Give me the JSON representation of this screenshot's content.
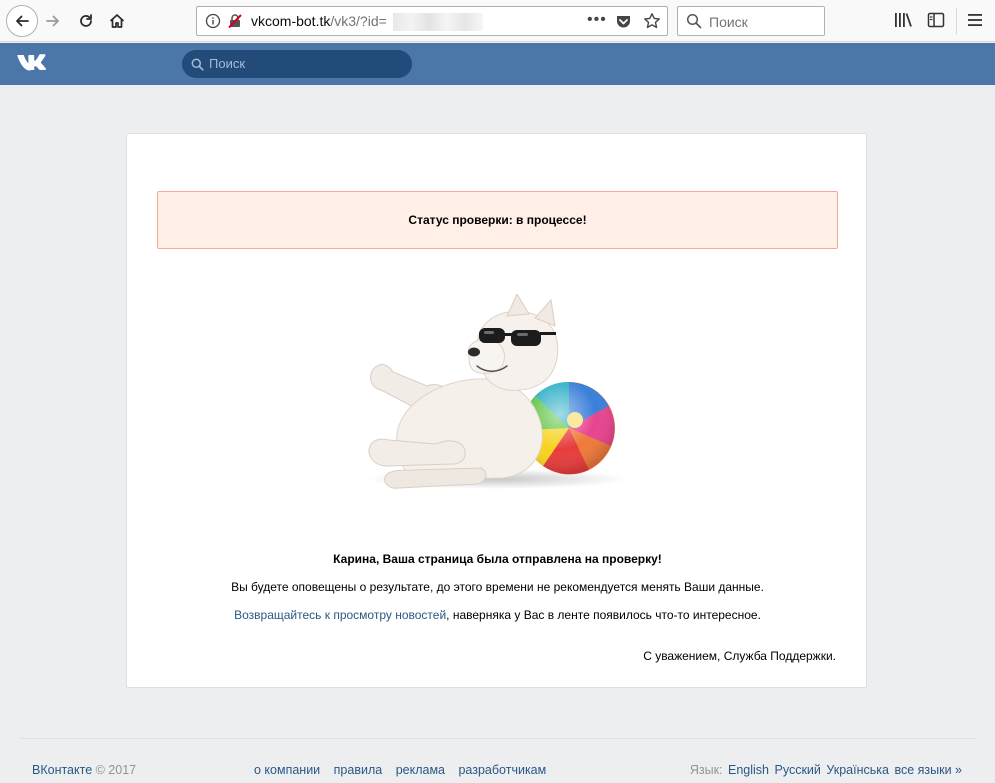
{
  "browser": {
    "url_host": "vkcom-bot.tk",
    "url_path": "/vk3/?id=",
    "search_placeholder": "Поиск",
    "more_label": "•••"
  },
  "vk": {
    "search_placeholder": "Поиск"
  },
  "status": {
    "text": "Статус проверки: в процессе!"
  },
  "message": {
    "title": "Карина, Ваша страница была отправлена на проверку!",
    "line1": "Вы будете оповещены о результате, до этого времени не рекомендуется менять Ваши данные.",
    "news_link": "Возвращайтесь к просмотру новостей",
    "line2_rest": ", наверняка у Вас в ленте появилось что-то интересное.",
    "signature": "С уважением, Служба Поддержки."
  },
  "footer": {
    "brand": "ВКонтакте",
    "copyright": " © 2017",
    "links": [
      "о компании",
      "правила",
      "реклама",
      "разработчикам"
    ],
    "lang_label": "Язык:",
    "languages": [
      "English",
      "Русский",
      "Українська",
      "все языки »"
    ]
  },
  "colors": {
    "vk_blue": "#4a76a8",
    "link": "#2a5885",
    "status_bg": "#ffefe6",
    "status_border": "#f2ab99"
  }
}
